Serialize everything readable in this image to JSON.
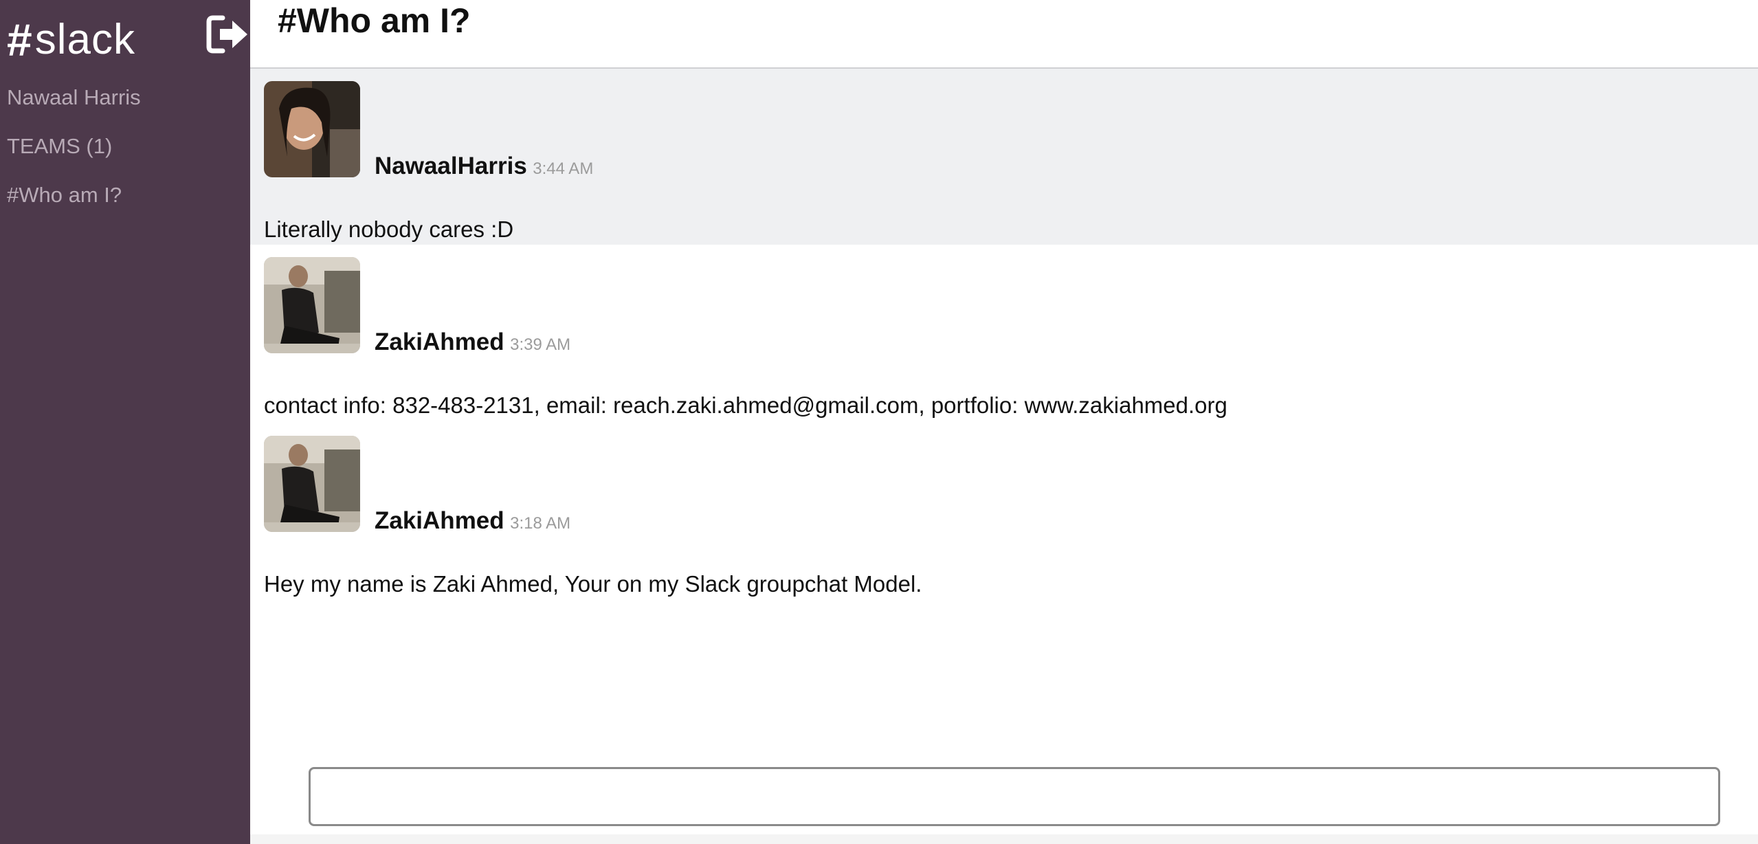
{
  "sidebar": {
    "brand": {
      "icon": "hash-icon",
      "name": "slack"
    },
    "logout_icon": "logout-icon",
    "current_user": "Nawaal Harris",
    "teams_label": "TEAMS (1)",
    "channel": "#Who am I?",
    "background_color": "#4d394b",
    "text_color": "#b8aab6"
  },
  "header": {
    "channel_title": "#Who am I?"
  },
  "messages": [
    {
      "username": "NawaalHarris",
      "time": "3:44 AM",
      "text": "Literally nobody cares :D",
      "highlighted": true
    },
    {
      "username": "ZakiAhmed",
      "time": "3:39 AM",
      "text": "contact info: 832-483-2131, email: reach.zaki.ahmed@gmail.com, portfolio: www.zakiahmed.org",
      "highlighted": false
    },
    {
      "username": "ZakiAhmed",
      "time": "3:18 AM",
      "text": "Hey my name is Zaki Ahmed, Your on my Slack groupchat Model.",
      "highlighted": false
    }
  ],
  "composer": {
    "value": "",
    "placeholder": ""
  }
}
